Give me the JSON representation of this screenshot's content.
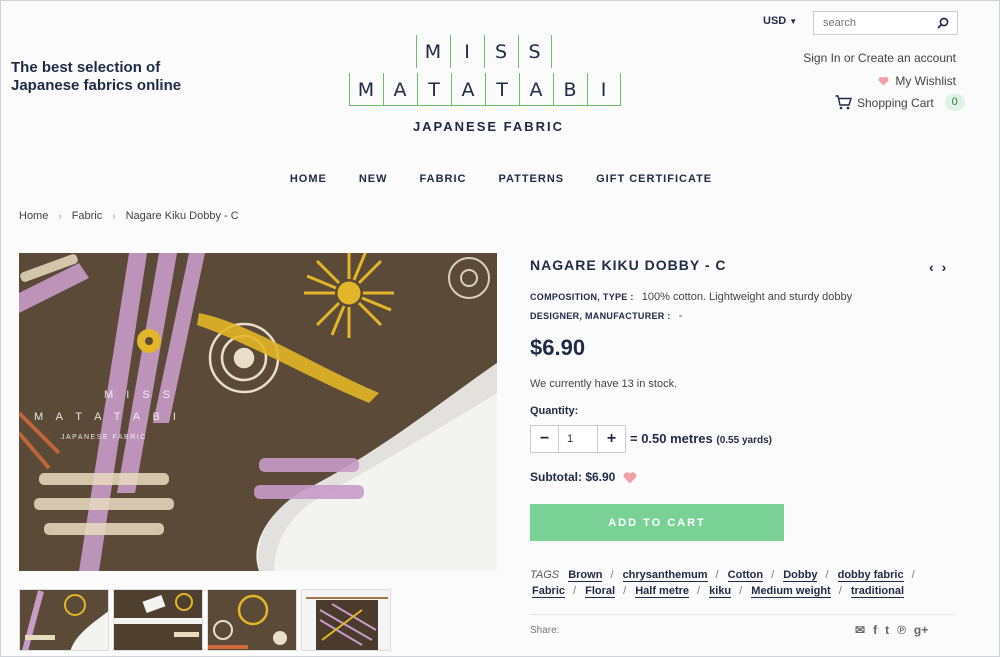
{
  "header": {
    "tagline": "The best selection of Japanese fabrics online",
    "logo_row1": [
      "M",
      "I",
      "S",
      "S"
    ],
    "logo_row2": [
      "M",
      "A",
      "T",
      "A",
      "T",
      "A",
      "B",
      "I"
    ],
    "logo_sub": "JAPANESE FABRIC",
    "currency": "USD",
    "search_placeholder": "search",
    "account_links": "Sign In or Create an account",
    "wishlist": "My Wishlist",
    "cart_label": "Shopping Cart",
    "cart_count": "0"
  },
  "nav": [
    "HOME",
    "NEW",
    "FABRIC",
    "PATTERNS",
    "GIFT CERTIFICATE"
  ],
  "breadcrumb": [
    "Home",
    "Fabric",
    "Nagare Kiku Dobby - C"
  ],
  "product": {
    "title": "NAGARE KIKU DOBBY - C",
    "composition_label": "COMPOSITION, TYPE :",
    "composition_value": "100% cotton. Lightweight and sturdy dobby",
    "designer_label": "DESIGNER, MANUFACTURER :",
    "designer_value": "-",
    "price": "$6.90",
    "stock": "We currently have 13 in stock.",
    "quantity_label": "Quantity:",
    "quantity_value": "1",
    "metres": "= 0.50 metres",
    "yards": "(0.55 yards)",
    "subtotal": "Subtotal: $6.90",
    "add_to_cart": "ADD TO CART",
    "tags_label": "TAGS",
    "tags": [
      "Brown",
      "chrysanthemum",
      "Cotton",
      "Dobby",
      "dobby fabric",
      "Fabric",
      "Floral",
      "Half metre",
      "kiku",
      "Medium weight",
      "traditional"
    ],
    "share_label": "Share:",
    "image_watermark_row1": "M I S S",
    "image_watermark_row2": "M A T A T A B I",
    "image_watermark_sub": "JAPANESE FABRIC"
  },
  "colors": {
    "navy": "#1f2a44",
    "logo_green": "#6bbf6a",
    "add_to_cart": "#79d195",
    "heart": "#f0a0a8"
  }
}
